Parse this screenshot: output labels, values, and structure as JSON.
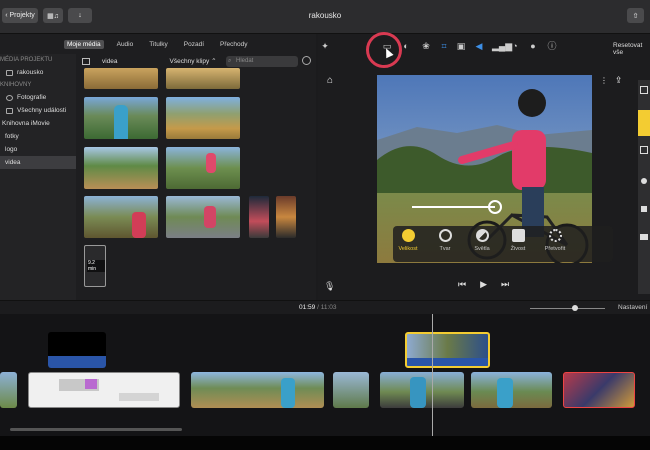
{
  "window": {
    "title": "rakousko"
  },
  "toolbar": {
    "projects_label": "Projekty"
  },
  "media_tabs": [
    "Moje média",
    "Audio",
    "Titulky",
    "Pozadí",
    "Přechody"
  ],
  "sidebar": {
    "project_media_header": "MÉDIA PROJEKTU",
    "project_item": "rakousko",
    "library_header": "KNIHOVNY",
    "items": [
      "Fotografie",
      "Všechny události",
      "Knihovna iMovie",
      "fotky",
      "logo",
      "videa"
    ]
  },
  "browser": {
    "folder_label": "videa",
    "filter_label": "Všechny klipy",
    "search_placeholder": "Hledat",
    "duration_badge": "9.2 min"
  },
  "viewer": {
    "reset_label": "Resetovat vše",
    "tools": [
      {
        "label": "Velikost",
        "icon": "aperture-icon"
      },
      {
        "label": "Tvar",
        "icon": "ring-icon"
      },
      {
        "label": "Světla",
        "icon": "exposure-icon"
      },
      {
        "label": "Živost",
        "icon": "paint-bucket-icon"
      },
      {
        "label": "Přetvořit",
        "icon": "gear-flower-icon"
      }
    ],
    "slider_value": 0.63
  },
  "timeline": {
    "current_time": "01:59",
    "total_time": "11:03",
    "settings_label": "Nastavení"
  },
  "colors": {
    "accent": "#f3cc32",
    "highlight": "#d93a52",
    "selection": "#3d3d40"
  }
}
